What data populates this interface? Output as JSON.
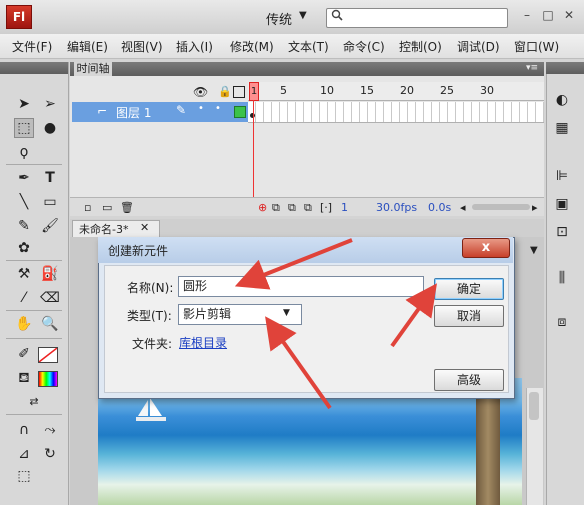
{
  "app": {
    "logo_text": "Fl",
    "workspace_label": "传统",
    "search_placeholder": ""
  },
  "menubar": [
    "文件(F)",
    "编辑(E)",
    "视图(V)",
    "插入(I)",
    "修改(M)",
    "文本(T)",
    "命令(C)",
    "控制(O)",
    "调试(D)",
    "窗口(W)"
  ],
  "timeline": {
    "panel_title": "时间轴",
    "frame_ticks": [
      "1",
      "5",
      "10",
      "15",
      "20",
      "25",
      "30"
    ],
    "layer_name": "图层 1",
    "current_frame": "1",
    "fps": "30.0fps",
    "time": "0.0s"
  },
  "document": {
    "tab_label": "未命名-3*"
  },
  "dialog": {
    "title": "创建新元件",
    "name_label": "名称(N):",
    "name_value": "圆形",
    "type_label": "类型(T):",
    "type_value": "影片剪辑",
    "folder_label": "文件夹:",
    "folder_value": "库根目录",
    "ok_label": "确定",
    "cancel_label": "取消",
    "advanced_label": "高级",
    "close_symbol": "x"
  },
  "colors": {
    "accent_arrow": "#e0433a",
    "layer_highlight": "#6a9fe0"
  }
}
